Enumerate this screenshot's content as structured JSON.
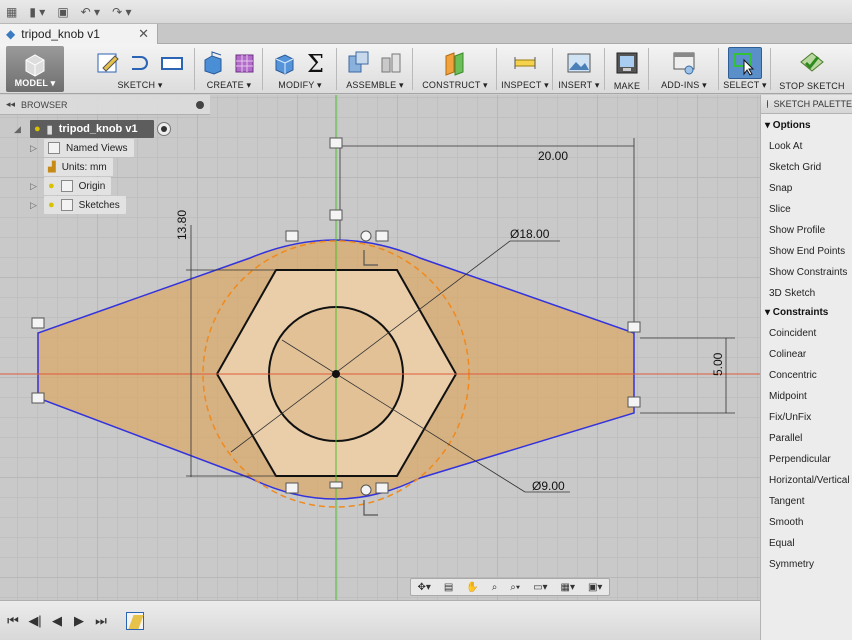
{
  "app": {
    "document_tab": "tripod_knob v1"
  },
  "toolbar": {
    "workspace_label": "MODEL ▾",
    "groups": [
      {
        "label": "SKETCH ▾"
      },
      {
        "label": "CREATE ▾"
      },
      {
        "label": "MODIFY ▾"
      },
      {
        "label": "ASSEMBLE ▾"
      },
      {
        "label": "CONSTRUCT ▾"
      },
      {
        "label": "INSPECT ▾"
      },
      {
        "label": "INSERT ▾"
      },
      {
        "label": "MAKE"
      },
      {
        "label": "ADD-INS ▾"
      },
      {
        "label": "SELECT ▾"
      },
      {
        "label": "STOP SKETCH"
      }
    ]
  },
  "browser": {
    "title": "BROWSER",
    "root": "tripod_knob v1",
    "items": [
      {
        "label": "Named Views"
      },
      {
        "label": "Units: mm"
      },
      {
        "label": "Origin"
      },
      {
        "label": "Sketches"
      }
    ]
  },
  "sketch": {
    "dims": {
      "width": "20.00",
      "height": "13.80",
      "outer_diameter": "Ø18.00",
      "inner_diameter": "Ø9.00",
      "edge": "5.00"
    }
  },
  "palette": {
    "title": "SKETCH PALETTE",
    "options_title": "▾ Options",
    "options": [
      "Look At",
      "Sketch Grid",
      "Snap",
      "Slice",
      "Show Profile",
      "Show End Points",
      "Show Constraints",
      "3D Sketch"
    ],
    "constraints_title": "▾ Constraints",
    "constraints": [
      "Coincident",
      "Colinear",
      "Concentric",
      "Midpoint",
      "Fix/UnFix",
      "Parallel",
      "Perpendicular",
      "Horizontal/Vertical",
      "Tangent",
      "Smooth",
      "Equal",
      "Symmetry"
    ]
  },
  "colors": {
    "profile_fill": "#d9a86a",
    "outline_blue": "#3333dd",
    "construction_orange": "#f08a1c",
    "axis_red": "#e05a3a",
    "axis_green": "#4cbf2a"
  }
}
